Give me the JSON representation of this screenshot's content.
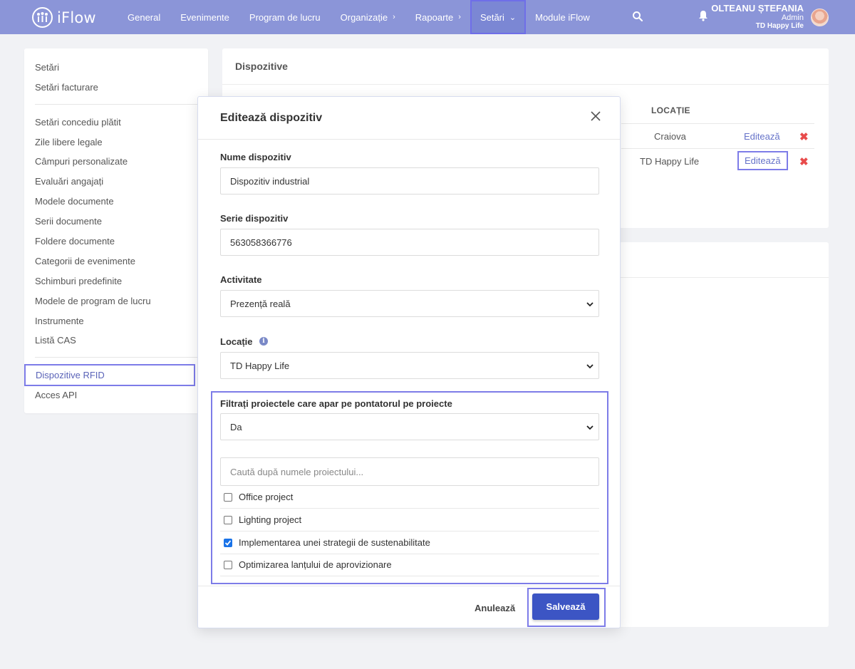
{
  "brand": {
    "name": "iFlow"
  },
  "nav": {
    "items": [
      {
        "label": "General"
      },
      {
        "label": "Evenimente"
      },
      {
        "label": "Program de lucru"
      },
      {
        "label": "Organizație",
        "chevron": "›"
      },
      {
        "label": "Rapoarte",
        "chevron": "›"
      },
      {
        "label": "Setări",
        "chevron": "⌄"
      },
      {
        "label": "Module iFlow"
      }
    ]
  },
  "user": {
    "name": "OLTEANU ȘTEFANIA",
    "role": "Admin",
    "company": "TD Happy Life"
  },
  "sidebar": {
    "items": [
      "Setări",
      "Setări facturare",
      "Setări concediu plătit",
      "Zile libere legale",
      "Câmpuri personalizate",
      "Evaluări angajați",
      "Modele documente",
      "Serii documente",
      "Foldere documente",
      "Categorii de evenimente",
      "Schimburi predefinite",
      "Modele de program de lucru",
      "Instrumente",
      "Listă CAS",
      "Dispozitive RFID",
      "Acces API"
    ]
  },
  "devices": {
    "title": "Dispozitive",
    "column_location": "LOCAȚIE",
    "rows": [
      {
        "location": "Craiova",
        "edit": "Editează",
        "delete": "✖"
      },
      {
        "location": "TD Happy Life",
        "edit": "Editează",
        "delete": "✖"
      }
    ]
  },
  "modal": {
    "title": "Editează dispozitiv",
    "name_label": "Nume dispozitiv",
    "name_value": "Dispozitiv industrial",
    "serial_label": "Serie dispozitiv",
    "serial_value": "563058366776",
    "activity_label": "Activitate",
    "activity_value": "Prezență reală",
    "location_label": "Locație",
    "location_value": "TD Happy Life",
    "filter_label": "Filtrați proiectele care apar pe pontatorul pe proiecte",
    "filter_value": "Da",
    "search_placeholder": "Caută după numele proiectului...",
    "projects": [
      {
        "name": "Office project",
        "checked": false
      },
      {
        "name": "Lighting project",
        "checked": false
      },
      {
        "name": "Implementarea unei strategii de sustenabilitate",
        "checked": true
      },
      {
        "name": "Optimizarea lanțului de aprovizionare",
        "checked": false
      }
    ],
    "cancel_label": "Anulează",
    "save_label": "Salvează"
  },
  "colors": {
    "nav": "#8b95d8",
    "accent": "#3c55c4",
    "highlight": "#7d7ce8",
    "danger": "#e84b4b"
  }
}
